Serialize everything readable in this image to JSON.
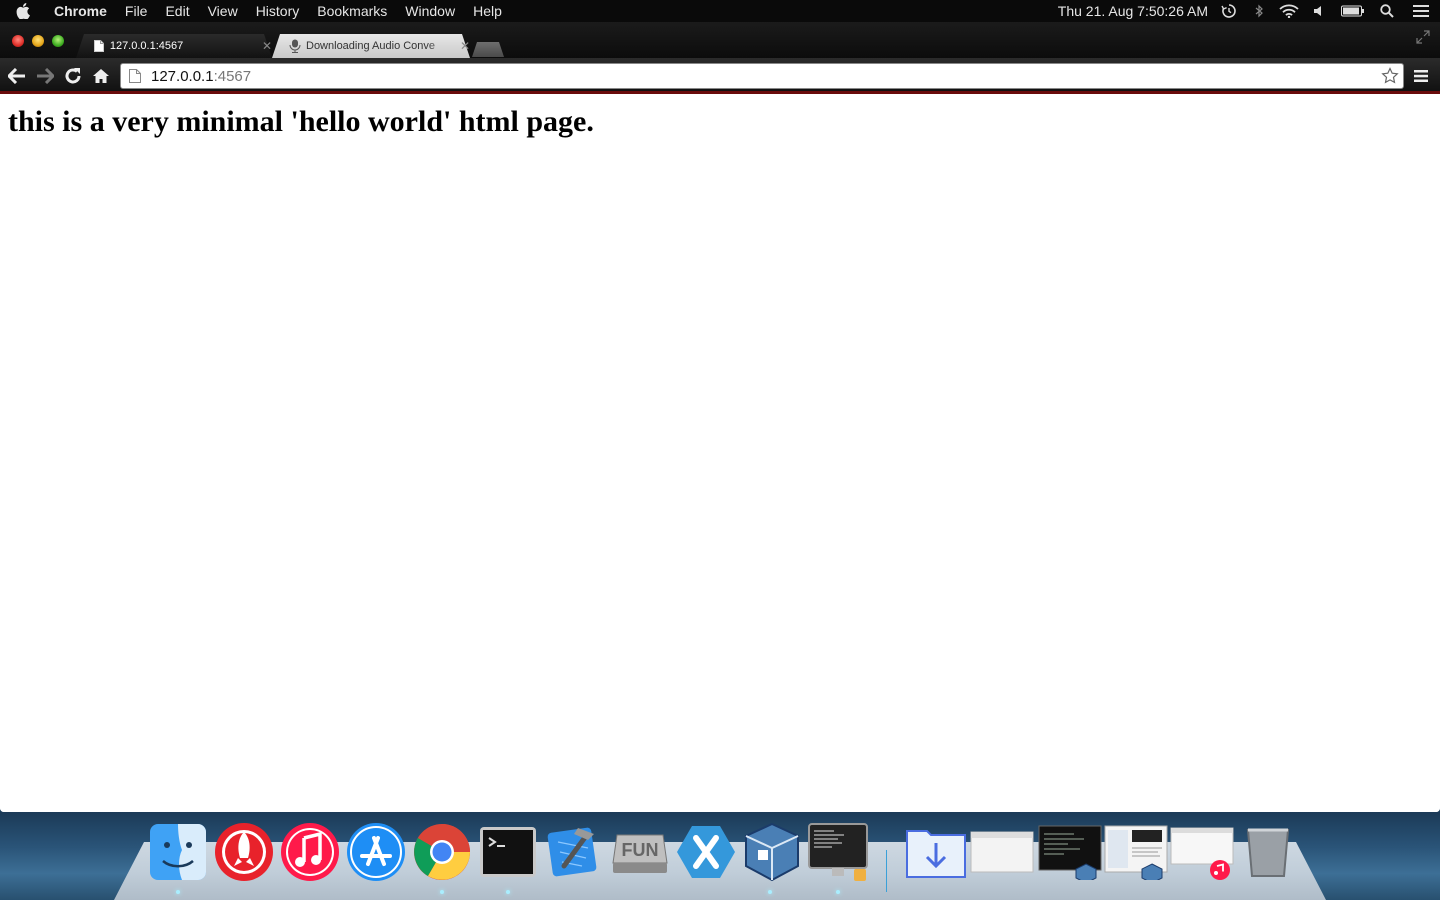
{
  "menubar": {
    "app_name": "Chrome",
    "menus": [
      "File",
      "Edit",
      "View",
      "History",
      "Bookmarks",
      "Window",
      "Help"
    ],
    "clock": "Thu 21. Aug  7:50:26 AM"
  },
  "tabs": [
    {
      "label": "127.0.0.1:4567",
      "active": true,
      "icon": "page-icon"
    },
    {
      "label": "Downloading Audio Conve",
      "active": false,
      "icon": "microphone-icon"
    }
  ],
  "omnibox": {
    "host": "127.0.0.1",
    "port": ":4567"
  },
  "page": {
    "heading": "this is a very minimal 'hello world' html page."
  },
  "dock": {
    "apps": [
      "finder-icon",
      "launchpad-icon",
      "itunes-icon",
      "app-store-icon",
      "chrome-icon",
      "terminal-icon",
      "xcode-icon",
      "fun-drive-icon",
      "xamarin-icon",
      "virtualbox-icon",
      "console-icon"
    ],
    "stacks": [
      "downloads-folder-icon",
      "minimized-window-1",
      "minimized-window-2",
      "minimized-window-3",
      "minimized-window-4",
      "trash-icon"
    ]
  },
  "colors": {
    "toolbar_accent": "#6a0b0b",
    "menubar_bg": "#0a0a0a",
    "page_bg": "#ffffff"
  }
}
